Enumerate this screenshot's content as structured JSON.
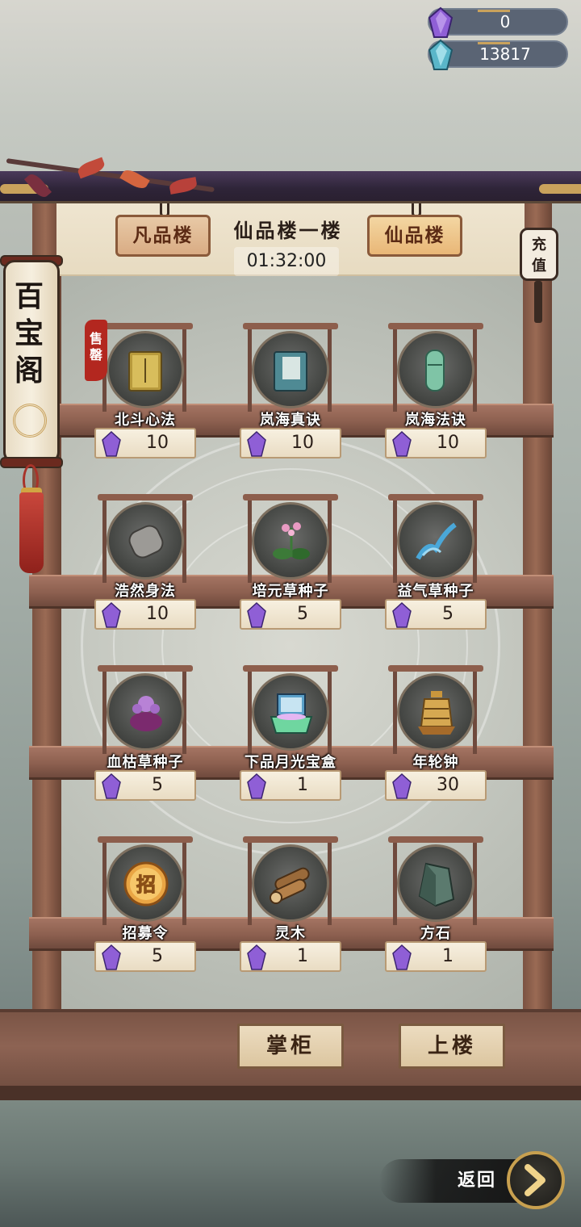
{
  "currency": {
    "premium": "0",
    "spirit_stones": "13817"
  },
  "header": {
    "tab_left": "凡品楼",
    "title": "仙品楼一楼",
    "tab_right": "仙品楼",
    "timer": "01:32:00"
  },
  "recharge": {
    "line1": "充",
    "line2": "值"
  },
  "banner": {
    "line1": "百",
    "line2": "宝",
    "line3": "阁"
  },
  "sold_badge": "售罄",
  "items": [
    {
      "name": "北斗心法",
      "price": "10",
      "sold_out": true
    },
    {
      "name": "岚海真诀",
      "price": "10"
    },
    {
      "name": "岚海法诀",
      "price": "10"
    },
    {
      "name": "浩然身法",
      "price": "10"
    },
    {
      "name": "培元草种子",
      "price": "5"
    },
    {
      "name": "益气草种子",
      "price": "5"
    },
    {
      "name": "血枯草种子",
      "price": "5"
    },
    {
      "name": "下品月光宝盒",
      "price": "1"
    },
    {
      "name": "年轮钟",
      "price": "30"
    },
    {
      "name": "招募令",
      "price": "5"
    },
    {
      "name": "灵木",
      "price": "1"
    },
    {
      "name": "方石",
      "price": "1"
    }
  ],
  "recruit_glyph": "招",
  "buttons": {
    "shopkeeper": "掌柜",
    "upstairs": "上楼",
    "back": "返回"
  },
  "colors": {
    "premium_gem": "#8f5fd6",
    "spirit_gem": "#5ab6c9",
    "wood": "#8c5f4f",
    "tab_gold": "#e9b777"
  }
}
